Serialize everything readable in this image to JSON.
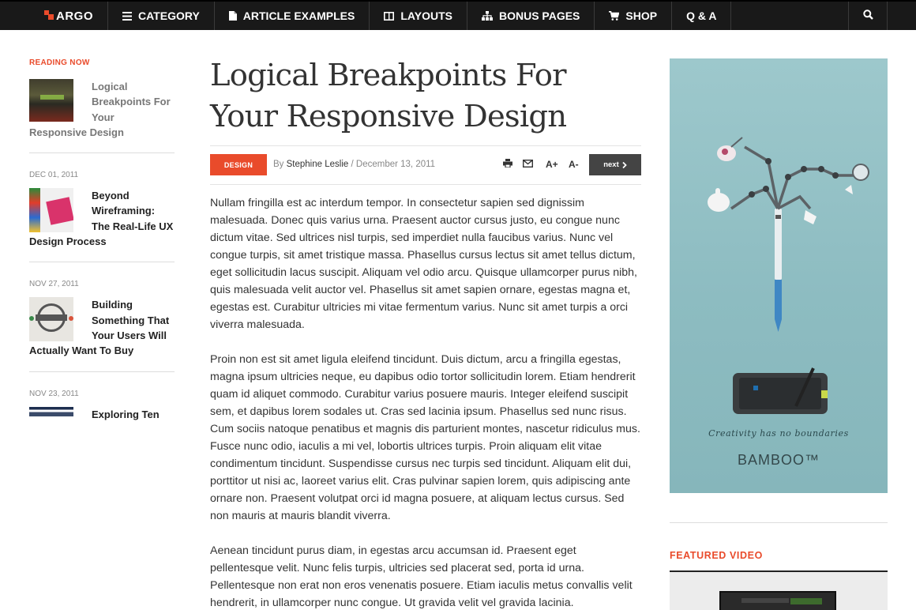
{
  "nav": {
    "logo": "ARGO",
    "items": [
      {
        "label": "CATEGORY",
        "icon": "list-icon"
      },
      {
        "label": "ARTICLE EXAMPLES",
        "icon": "document-icon"
      },
      {
        "label": "LAYOUTS",
        "icon": "columns-icon"
      },
      {
        "label": "BONUS PAGES",
        "icon": "sitemap-icon"
      },
      {
        "label": "SHOP",
        "icon": "cart-icon"
      },
      {
        "label": "Q & A",
        "icon": ""
      }
    ],
    "search_icon": "search-icon"
  },
  "sidebar": {
    "heading": "READING NOW",
    "items": [
      {
        "date": "",
        "title": "Logical Breakpoints For Your Responsive Design"
      },
      {
        "date": "DEC 01, 2011",
        "title": "Beyond Wireframing: The Real-Life UX Design Process"
      },
      {
        "date": "NOV 27, 2011",
        "title": "Building Something That Your Users Will Actually Want To Buy"
      },
      {
        "date": "NOV 23, 2011",
        "title": "Exploring Ten"
      }
    ]
  },
  "article": {
    "title": "Logical Breakpoints For Your Responsive Design",
    "category": "DESIGN",
    "by": "By",
    "author": "Stephine Leslie",
    "separator": "/",
    "date": "December 13, 2011",
    "font_up": "A+",
    "font_down": "A-",
    "next": "next",
    "paragraphs": [
      "Nullam fringilla est ac interdum tempor. In consectetur sapien sed dignissim malesuada. Donec quis varius urna. Praesent auctor cursus justo, eu congue nunc dictum vitae. Sed ultrices nisl turpis, sed imperdiet nulla faucibus varius. Nunc vel congue turpis, sit amet tristique massa. Phasellus cursus lectus sit amet tellus dictum, eget sollicitudin lacus suscipit. Aliquam vel odio arcu. Quisque ullamcorper purus nibh, quis malesuada velit auctor vel. Phasellus sit amet sapien ornare, egestas magna et, egestas est. Curabitur ultricies mi vitae fermentum varius. Nunc sit amet turpis a orci viverra malesuada.",
      "Proin non est sit amet ligula eleifend tincidunt. Duis dictum, arcu a fringilla egestas, magna ipsum ultricies neque, eu dapibus odio tortor sollicitudin lorem. Etiam hendrerit quam id aliquet commodo. Curabitur varius posuere mauris. Integer eleifend suscipit sem, et dapibus lorem sodales ut. Cras sed lacinia ipsum. Phasellus sed nunc risus. Cum sociis natoque penatibus et magnis dis parturient montes, nascetur ridiculus mus. Fusce nunc odio, iaculis a mi vel, lobortis ultrices turpis. Proin aliquam elit vitae condimentum tincidunt. Suspendisse cursus nec turpis sed tincidunt. Aliquam elit dui, porttitor ut nisi ac, laoreet varius elit. Cras pulvinar sapien lorem, quis adipiscing ante ornare non. Praesent volutpat orci id magna posuere, at aliquam lectus cursus. Sed non mauris at mauris blandit viverra.",
      "Aenean tincidunt purus diam, in egestas arcu accumsan id. Praesent eget pellentesque velit. Nunc felis turpis, ultricies sed placerat sed, porta id urna. Pellentesque non erat non eros venenatis posuere. Etiam iaculis metus convallis velit hendrerit, in ullamcorper nunc congue. Ut gravida velit vel gravida lacinia."
    ]
  },
  "ad": {
    "tagline": "Creativity has no boundaries",
    "brand": "BAMBOO™"
  },
  "featured": {
    "title": "FEATURED VIDEO"
  },
  "colors": {
    "accent": "#e94b2b",
    "nav_bg": "#191919",
    "ad_bg": "#9dc8cc"
  }
}
